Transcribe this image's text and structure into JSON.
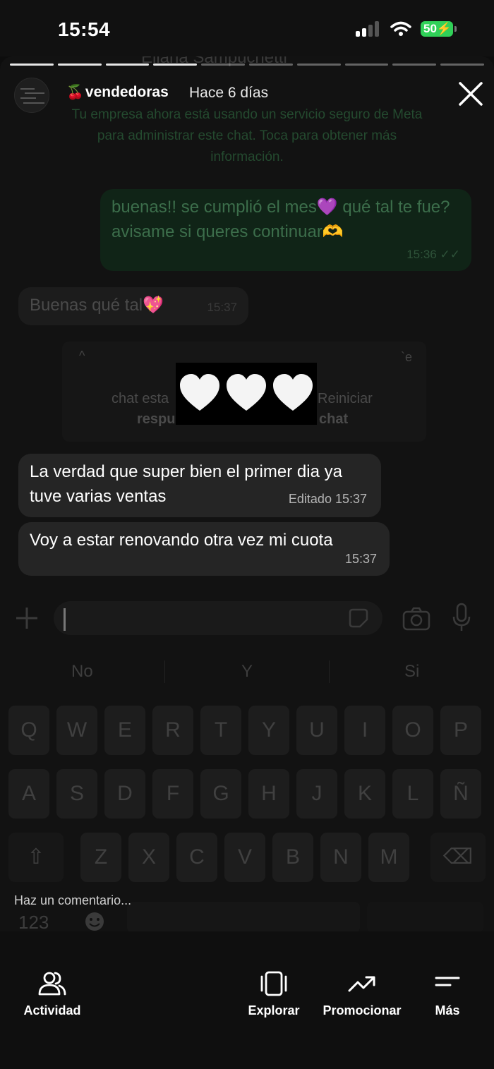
{
  "status_bar": {
    "time": "15:54",
    "battery": "50"
  },
  "story": {
    "account": "vendedoras",
    "time_ago": "Hace 6 días",
    "progress_segments": 10,
    "progress_done": 4
  },
  "chat": {
    "ghost_header": "Eliana  Sampuchetti",
    "notice": "Tu empresa ahora está usando un servicio seguro de Meta para administrar este chat. Toca para obtener más información.",
    "outgoing": {
      "text": "buenas!! se cumplió el mes💜 qué tal te fue? avisame si queres continuar🫶",
      "time": "15:36"
    },
    "incoming_1": {
      "text": "Buenas qué tal💖",
      "time": "15:37"
    },
    "ghost_card": {
      "line1a": "chat esta",
      "line2a": "respu",
      "line1b": "Reiniciar",
      "line2b": "chat",
      "corner_a": "^",
      "corner_b": "`e"
    },
    "sticker": "🤍🤍🤍",
    "incoming_2": {
      "text": "La verdad que super bien el primer dia ya tuve varias ventas",
      "meta": "Editado 15:37"
    },
    "incoming_3": {
      "text": "Voy a estar renovando otra vez mi cuota",
      "time": "15:37"
    }
  },
  "keyboard": {
    "suggestions": [
      "No",
      "Y",
      "Si"
    ],
    "row1": [
      "Q",
      "W",
      "E",
      "R",
      "T",
      "Y",
      "U",
      "I",
      "O",
      "P"
    ],
    "row2": [
      "A",
      "S",
      "D",
      "F",
      "G",
      "H",
      "J",
      "K",
      "L",
      "Ñ"
    ],
    "row3": [
      "Z",
      "X",
      "C",
      "V",
      "B",
      "N",
      "M"
    ],
    "numbers_key": "123"
  },
  "comment": {
    "placeholder": "Haz un comentario..."
  },
  "bottom_nav": {
    "actividad": "Actividad",
    "explorar": "Explorar",
    "promocionar": "Promocionar",
    "mas": "Más"
  }
}
